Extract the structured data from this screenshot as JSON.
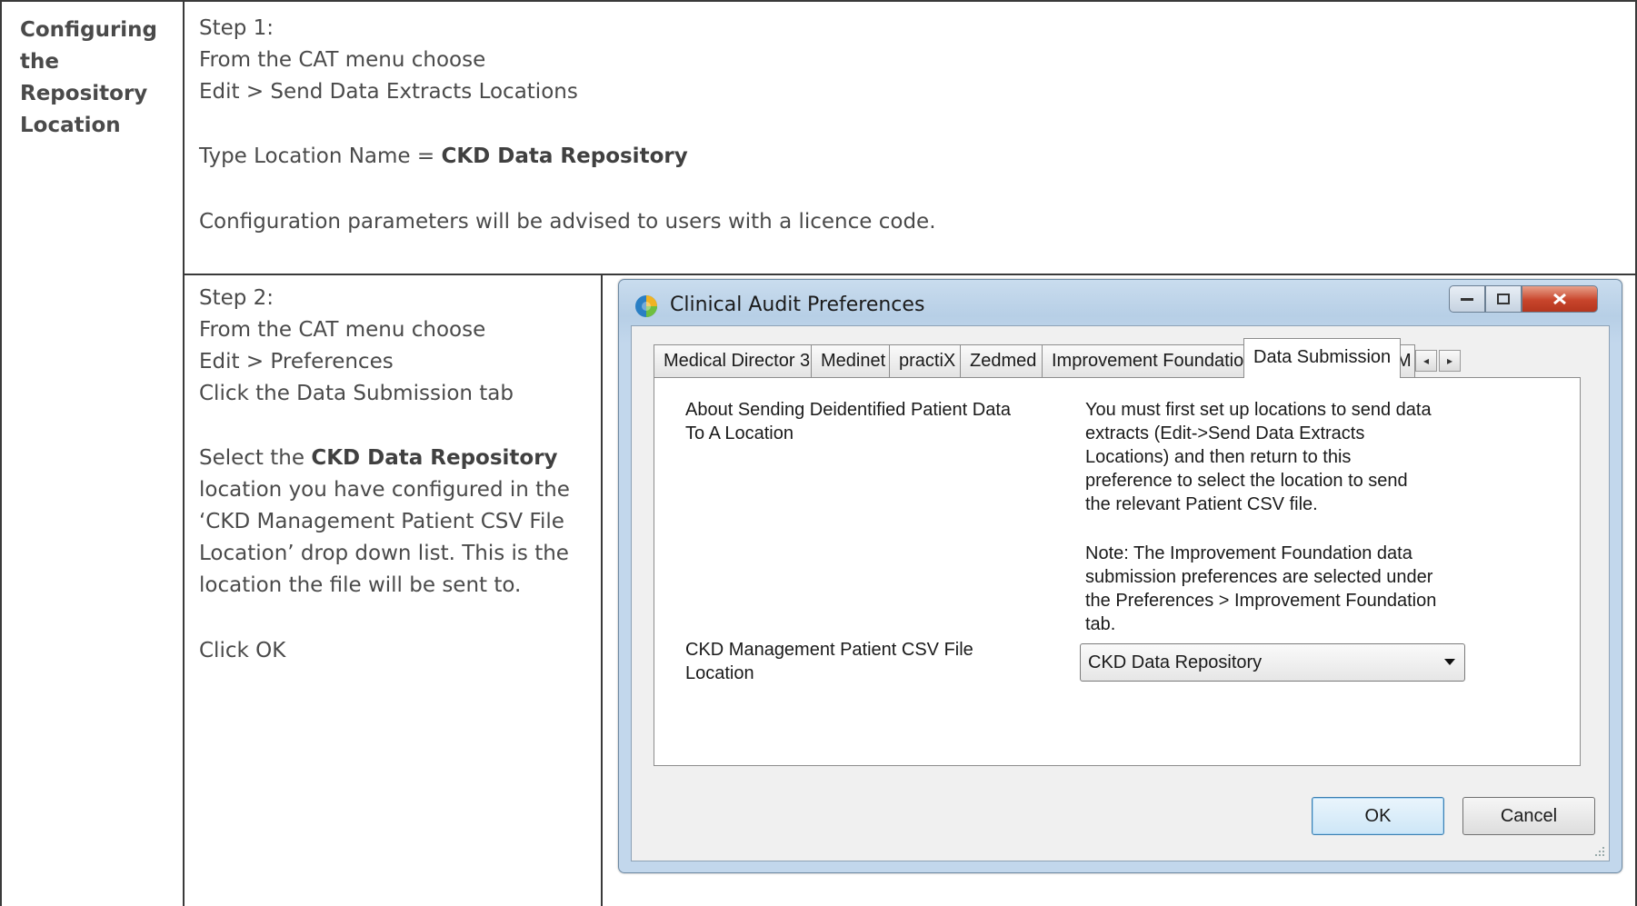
{
  "section": {
    "heading_lines": [
      "Configuring",
      "the",
      "Repository",
      "Location"
    ]
  },
  "step1": {
    "title": "Step 1:",
    "line1": "From the CAT menu choose",
    "line2": "Edit > Send Data Extracts Locations",
    "location_prefix": "Type Location Name = ",
    "location_name": "CKD Data Repository",
    "note": "Configuration parameters will be advised to users with a licence code."
  },
  "step2": {
    "title": "Step 2:",
    "line1": "From the CAT menu choose",
    "line2": "Edit > Preferences",
    "line3": "Click the Data Submission tab",
    "select_prefix": "Select the ",
    "select_bold": "CKD Data Repository",
    "desc_lines": [
      "location you have configured in the",
      "‘CKD Management Patient CSV File",
      "Location’ drop down list. This is the",
      "location the file will be sent to."
    ],
    "click_ok": "Click OK"
  },
  "dialog": {
    "title": "Clinical Audit Preferences",
    "tabs": [
      "Medical Director 3",
      "Medinet",
      "practiX",
      "Zedmed",
      "Improvement Foundation",
      "Data Submission",
      "M"
    ],
    "active_tab": "Data Submission",
    "about_label": [
      "About Sending Deidentified Patient Data",
      "To A Location"
    ],
    "about_text": [
      "You must first set up locations to send data",
      "extracts (Edit->Send Data Extracts",
      "Locations) and then return to this",
      "preference to select the location to send",
      "the relevant Patient CSV file."
    ],
    "note_text": [
      "Note: The Improvement Foundation data",
      "submission preferences are selected under",
      "the Preferences > Improvement Foundation",
      "tab."
    ],
    "csv_label": [
      "CKD Management Patient CSV File",
      "Location"
    ],
    "csv_value": "CKD Data Repository",
    "ok_label": "OK",
    "cancel_label": "Cancel"
  },
  "colors": {
    "text": "#4a4a4a",
    "title_bar": "#c2d7ec",
    "close_button": "#c8452b",
    "ok_focus": "#3c7fb1"
  }
}
